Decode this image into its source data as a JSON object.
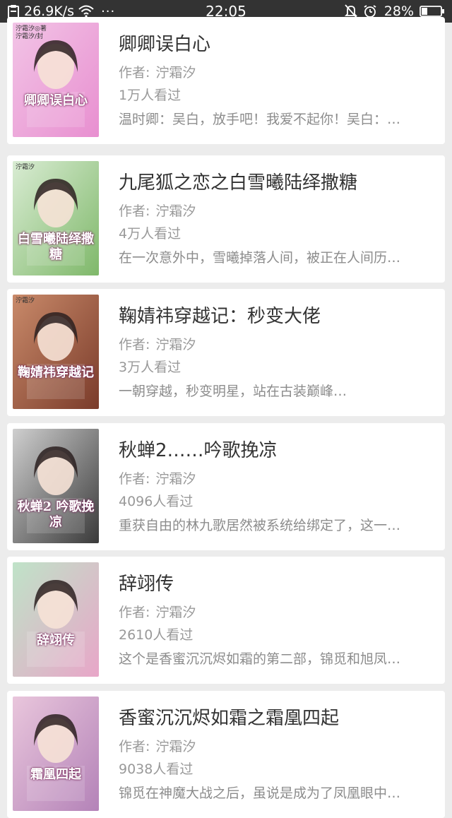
{
  "status_bar": {
    "speed": "26.9K/s",
    "dots": "···",
    "time": "22:05",
    "battery": "28%"
  },
  "author_label": "作者:",
  "books": [
    {
      "title": "卿卿误白心",
      "author": "泞霜汐",
      "views": "1万人看过",
      "desc": "温时卿：吴白，放手吧！我爱不起你！吴白：…",
      "cover_text": "卿卿误白心",
      "cover_credit": "泞霜汐◎著\n泞霜汐/封",
      "cover_colors": [
        "#f2c4e6",
        "#e88fd0"
      ]
    },
    {
      "title": "九尾狐之恋之白雪曦陆绎撒糖",
      "author": "泞霜汐",
      "views": "4万人看过",
      "desc": "在一次意外中，雪曦掉落人间，被正在人间历…",
      "cover_text": "白雪曦陆绎撒糖",
      "cover_credit": "泞霜汐",
      "cover_colors": [
        "#d9ecd3",
        "#7fb86a"
      ]
    },
    {
      "title": "鞠婧祎穿越记：秒变大佬",
      "author": "泞霜汐",
      "views": "3万人看过",
      "desc": "一朝穿越，秒变明星，站在古装巅峰…",
      "cover_text": "鞠婧祎穿越记",
      "cover_credit": "泞霜汐",
      "cover_colors": [
        "#c98a6a",
        "#7a3b2a"
      ]
    },
    {
      "title": "秋蝉2……吟歌挽凉",
      "author": "泞霜汐",
      "views": "4096人看过",
      "desc": "重获自由的林九歌居然被系统给绑定了，这一…",
      "cover_text": "秋蝉2 吟歌挽凉",
      "cover_credit": "",
      "cover_colors": [
        "#cfcfcf",
        "#3a3a3a"
      ]
    },
    {
      "title": "辞翊传",
      "author": "泞霜汐",
      "views": "2610人看过",
      "desc": "这个是香蜜沉沉烬如霜的第二部，锦觅和旭凤…",
      "cover_text": "辞翊传",
      "cover_credit": "",
      "cover_colors": [
        "#bfe3c8",
        "#e8a6c8"
      ]
    },
    {
      "title": "香蜜沉沉烬如霜之霜凰四起",
      "author": "泞霜汐",
      "views": "9038人看过",
      "desc": "锦觅在神魔大战之后，虽说是成为了凤凰眼中…",
      "cover_text": "霜凰四起",
      "cover_credit": "",
      "cover_colors": [
        "#e9c6dc",
        "#b483b8"
      ]
    }
  ]
}
